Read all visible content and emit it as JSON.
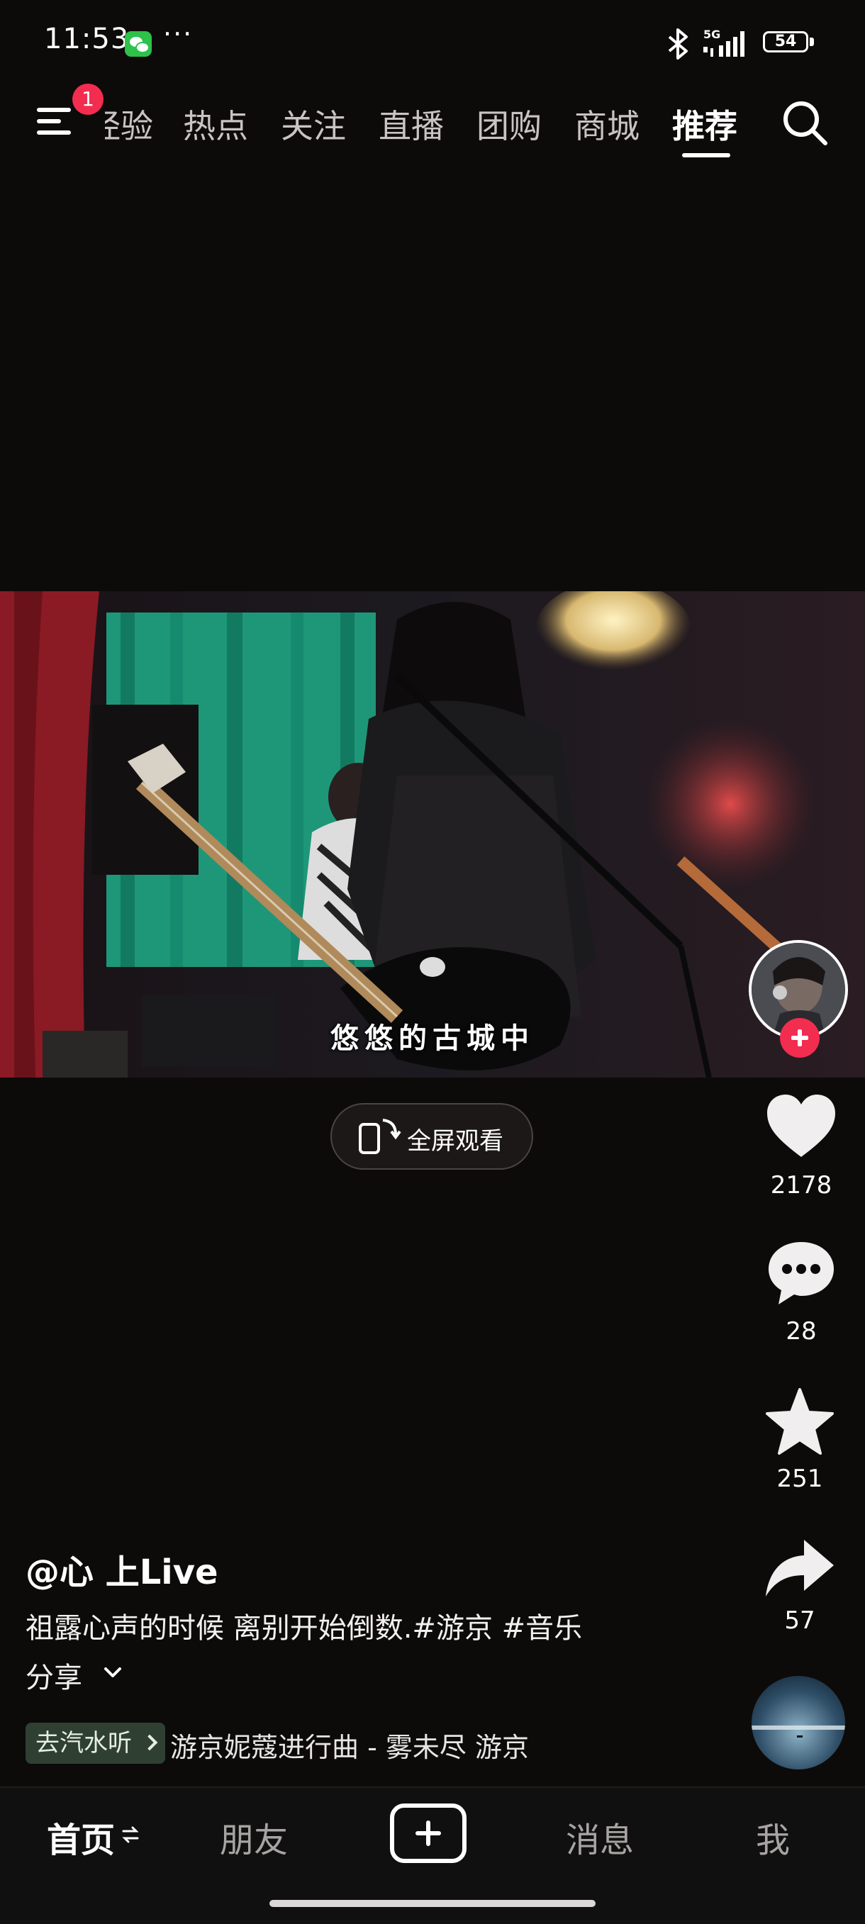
{
  "status_bar": {
    "time": "11:53",
    "more": "···",
    "network": "5G",
    "battery": "54",
    "icons": [
      "wechat-icon",
      "bluetooth-icon",
      "signal-icon",
      "battery-icon"
    ]
  },
  "top_nav": {
    "menu_badge": "1",
    "tabs": [
      "经验",
      "热点",
      "关注",
      "直播",
      "团购",
      "商城",
      "推荐"
    ],
    "active_tab": "推荐"
  },
  "video": {
    "subtitle": "悠悠的古城中",
    "fullscreen_label": "全屏观看"
  },
  "actions": {
    "likes": "2178",
    "comments": "28",
    "favorites": "251",
    "shares": "57"
  },
  "post": {
    "author": "@心 上Live",
    "description": "祖露心声的时候 离别开始倒数.#游京 #音乐",
    "share_label": "分享",
    "music_tag": "去汽水听",
    "music_title": "游京妮蔻进行曲 - 雾未尽    游京"
  },
  "bottom_nav": {
    "home": "首页",
    "friends": "朋友",
    "messages": "消息",
    "me": "我"
  },
  "colors": {
    "accent": "#f22d4f",
    "background": "#0d0a0a",
    "music_tag_bg": "#2f4032"
  }
}
